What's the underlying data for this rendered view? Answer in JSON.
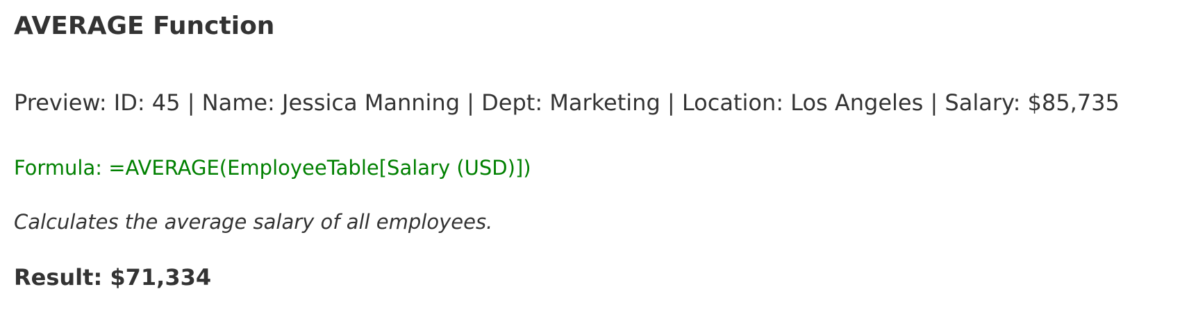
{
  "title": "AVERAGE Function",
  "preview": "Preview: ID: 45 | Name: Jessica Manning | Dept: Marketing | Location: Los Angeles | Salary: $85,735",
  "formula": "Formula: =AVERAGE(EmployeeTable[Salary (USD)])",
  "description": "Calculates the average salary of all employees.",
  "result": "Result: $71,334",
  "colors": {
    "text": "#333333",
    "formula": "#008000",
    "background": "#ffffff"
  }
}
